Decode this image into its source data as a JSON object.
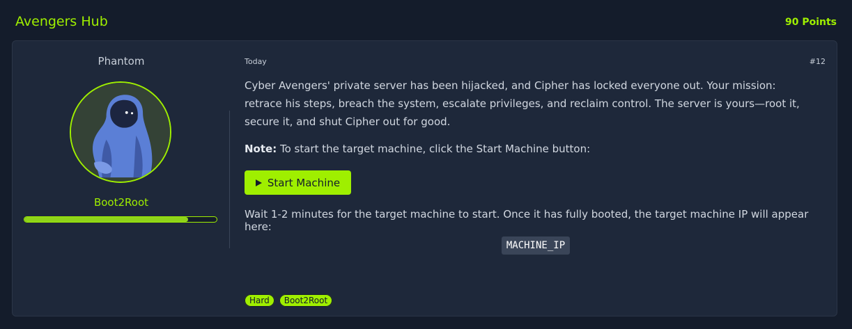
{
  "header": {
    "title": "Avengers Hub",
    "points": "90 Points"
  },
  "author": {
    "name": "Phantom",
    "avatar_icon": "hooded-figure-avatar",
    "rank": "Boot2Root",
    "progress_fraction": 0.85
  },
  "task": {
    "posted": "Today",
    "number": "#12",
    "description": "Cyber Avengers' private server has been hijacked, and Cipher has locked everyone out. Your mission: retrace his steps, breach the system, escalate privileges, and reclaim control. The server is yours—root it, secure it, and shut Cipher out for good.",
    "note_label": "Note:",
    "note_text": " To start the target machine, click the Start Machine button:",
    "start_button_label": "Start Machine",
    "wait_text": "Wait 1-2 minutes for the target machine to start. Once it has fully booted, the target machine IP will appear here:",
    "machine_ip": "MACHINE_IP",
    "tags": [
      "Hard",
      "Boot2Root"
    ]
  },
  "colors": {
    "accent": "#9fef00",
    "background": "#141c2b",
    "card": "#1e283a"
  }
}
